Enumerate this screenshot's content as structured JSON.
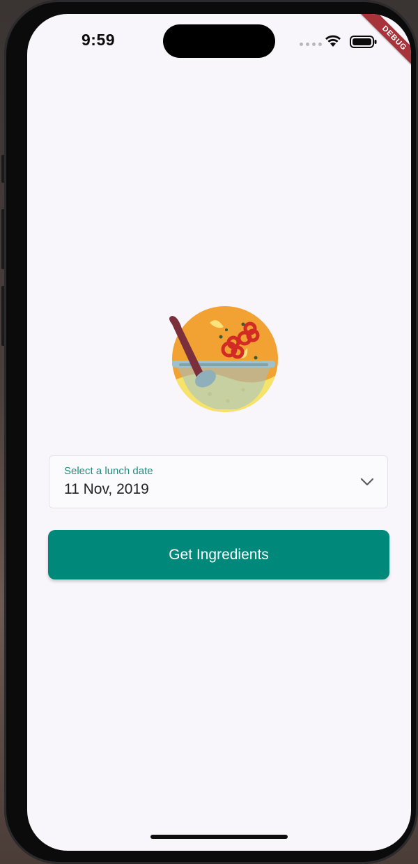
{
  "status_bar": {
    "time": "9:59",
    "wifi_icon": "wifi-icon",
    "battery_icon": "battery-icon"
  },
  "debug_banner": "DEBUG",
  "logo": {
    "icon": "cooking-pot-icon",
    "colors": {
      "circle": "#f2a233",
      "bowl": "#9fc1cc",
      "soup": "#f6e36a",
      "spoon": "#7a2f3a",
      "pepper": "#d22a24"
    }
  },
  "date_picker": {
    "label": "Select a lunch date",
    "value": "11 Nov, 2019",
    "icon": "chevron-down-icon"
  },
  "actions": {
    "get_ingredients_label": "Get Ingredients"
  },
  "colors": {
    "accent": "#00897b",
    "label": "#1e8c7e",
    "background": "#f8f6fa"
  }
}
